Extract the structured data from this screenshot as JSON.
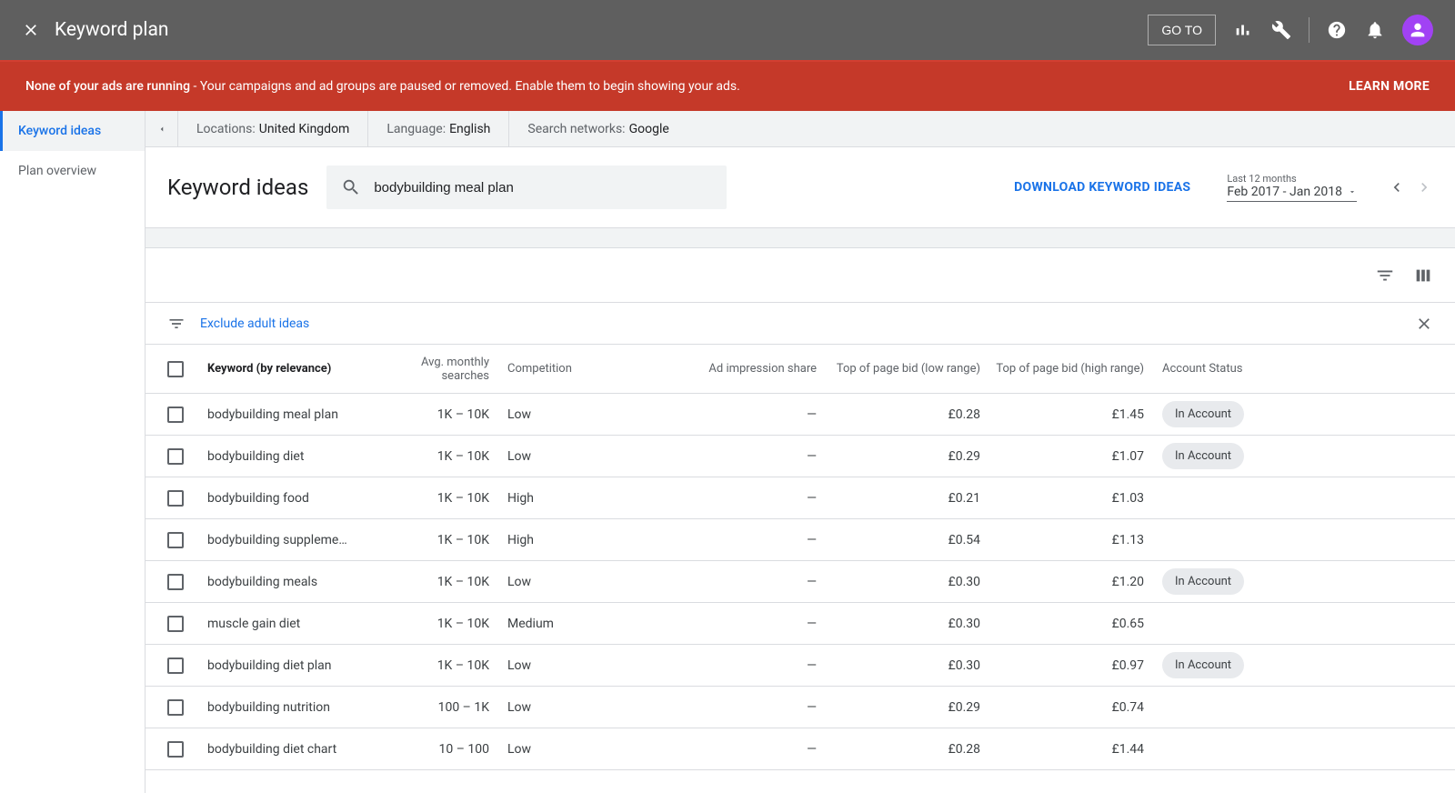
{
  "topbar": {
    "title": "Keyword plan",
    "goto": "GO TO"
  },
  "alert": {
    "bold": "None of your ads are running",
    "rest": " - Your campaigns and ad groups are paused or removed. Enable them to begin showing your ads.",
    "learn": "LEARN MORE"
  },
  "sidebar": {
    "items": [
      {
        "label": "Keyword ideas",
        "active": true
      },
      {
        "label": "Plan overview",
        "active": false
      }
    ]
  },
  "filters": {
    "locations_lbl": "Locations:",
    "locations_val": "United Kingdom",
    "language_lbl": "Language:",
    "language_val": "English",
    "networks_lbl": "Search networks:",
    "networks_val": "Google"
  },
  "header": {
    "title": "Keyword ideas",
    "search_value": "bodybuilding meal plan",
    "download": "DOWNLOAD KEYWORD IDEAS",
    "date_lbl": "Last 12 months",
    "date_range": "Feb 2017 - Jan 2018"
  },
  "filter_row": {
    "exclude": "Exclude adult ideas"
  },
  "table": {
    "columns": {
      "keyword": "Keyword (by relevance)",
      "searches": "Avg. monthly searches",
      "competition": "Competition",
      "impression": "Ad impression share",
      "bidlow": "Top of page bid (low range)",
      "bidhigh": "Top of page bid (high range)",
      "status": "Account Status"
    },
    "status_label": "In Account",
    "rows": [
      {
        "keyword": "bodybuilding meal plan",
        "searches": "1K – 10K",
        "competition": "Low",
        "impression": "—",
        "bidlow": "£0.28",
        "bidhigh": "£1.45",
        "in_account": true
      },
      {
        "keyword": "bodybuilding diet",
        "searches": "1K – 10K",
        "competition": "Low",
        "impression": "—",
        "bidlow": "£0.29",
        "bidhigh": "£1.07",
        "in_account": true
      },
      {
        "keyword": "bodybuilding food",
        "searches": "1K – 10K",
        "competition": "High",
        "impression": "—",
        "bidlow": "£0.21",
        "bidhigh": "£1.03",
        "in_account": false
      },
      {
        "keyword": "bodybuilding suppleme…",
        "searches": "1K – 10K",
        "competition": "High",
        "impression": "—",
        "bidlow": "£0.54",
        "bidhigh": "£1.13",
        "in_account": false
      },
      {
        "keyword": "bodybuilding meals",
        "searches": "1K – 10K",
        "competition": "Low",
        "impression": "—",
        "bidlow": "£0.30",
        "bidhigh": "£1.20",
        "in_account": true
      },
      {
        "keyword": "muscle gain diet",
        "searches": "1K – 10K",
        "competition": "Medium",
        "impression": "—",
        "bidlow": "£0.30",
        "bidhigh": "£0.65",
        "in_account": false
      },
      {
        "keyword": "bodybuilding diet plan",
        "searches": "1K – 10K",
        "competition": "Low",
        "impression": "—",
        "bidlow": "£0.30",
        "bidhigh": "£0.97",
        "in_account": true
      },
      {
        "keyword": "bodybuilding nutrition",
        "searches": "100 – 1K",
        "competition": "Low",
        "impression": "—",
        "bidlow": "£0.29",
        "bidhigh": "£0.74",
        "in_account": false
      },
      {
        "keyword": "bodybuilding diet chart",
        "searches": "10 – 100",
        "competition": "Low",
        "impression": "—",
        "bidlow": "£0.28",
        "bidhigh": "£1.44",
        "in_account": false
      }
    ]
  }
}
